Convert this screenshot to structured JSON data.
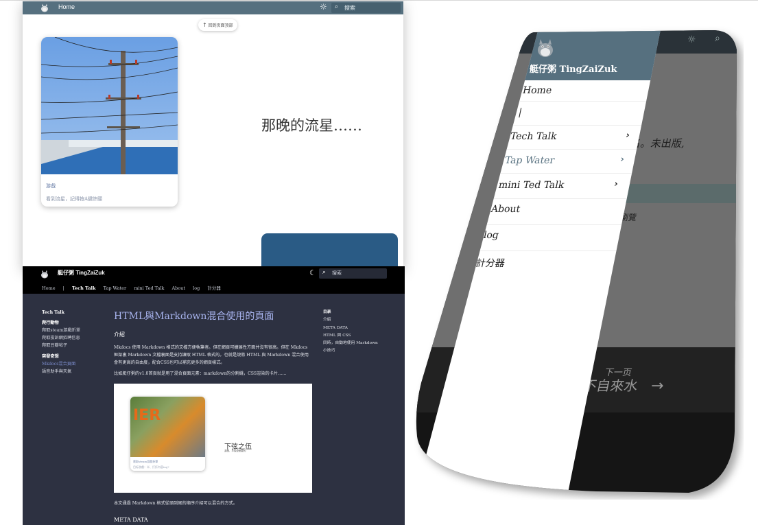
{
  "light": {
    "nav": {
      "home": "Home",
      "search_placeholder": "搜索"
    },
    "back_to_top": "回到页面顶部",
    "card": {
      "caption": "游戲",
      "desc": "看到流星，記得按A鍵許願"
    },
    "heading": "那晚的流星……"
  },
  "dark": {
    "site_name": "艇仔粥 TingZaiZuk",
    "search_placeholder": "搜索",
    "tabs": [
      "Home",
      "|",
      "Tech Talk",
      "Tap Water",
      "mini Ted Talk",
      "About",
      "log",
      "計分器"
    ],
    "left_nav": {
      "title": "Tech Talk",
      "items": [
        "爬行動物",
        "爬取steam游戲折單",
        "爬取投訴網招聘信息",
        "爬取豆瓣帖子",
        "突發奇想",
        "Mkdocs混合頁面",
        "語音助手與天氣"
      ]
    },
    "page": {
      "title": "HTML與Markdown混合使用的頁面",
      "intro_heading": "介紹",
      "intro_p1": "Mkdocs 使用 Markdown 格式的文檔方便執筆者。但在網頁可擴展性方面并沒有很高。但在 Mkdocs 框架裏 Markdown 文檔裏面是支持讀取 HTML 格式的。也就是說將 HTML 與 Markdown 混合使用會有更高的自由度，配合CSS也可以補充更多的網頁樣式。",
      "intro_p2": "比如艇仔粥的v1.0首頁就是用了混合頁面元素：markdown的分割綫，CSS渲染的卡片……",
      "embed": {
        "game_text": "IER",
        "card_caption": "爬取steam游戲折單",
        "card_desc": "目标游戲：半、打折內容ing?",
        "title": "下弦之伍",
        "subtitle": "游戲、半價全都要的"
      },
      "after_embed": "本文通過 Markdown 格式從頭到尾的順序介紹可以混合的方式。",
      "section2": "META DATA"
    },
    "toc": {
      "title": "目录",
      "items": [
        "介紹",
        "META DATA",
        "HTML 與 CSS",
        "同時，自動地使用 Markdown",
        "小技巧"
      ]
    }
  },
  "phone": {
    "site_name": "艇仔粥 TingZaiZuk",
    "nav": [
      {
        "label": "Home",
        "chevron": false,
        "selected": false
      },
      {
        "label": "|",
        "chevron": false,
        "selected": false
      },
      {
        "label": "Tech Talk",
        "chevron": true,
        "selected": false
      },
      {
        "label": "Tap Water",
        "chevron": true,
        "selected": true
      },
      {
        "label": "mini Ted Talk",
        "chevron": true,
        "selected": false
      },
      {
        "label": "About",
        "chevron": false,
        "selected": false
      },
      {
        "label": "log",
        "chevron": false,
        "selected": false
      },
      {
        "label": "計分器",
        "chevron": false,
        "selected": false
      }
    ],
    "bg_text1": "取名。未出版,",
    "bg_text2": "瀏覽",
    "next_label": "下一页",
    "next_title": "不自來水",
    "colors": {
      "header": "#56707f",
      "selected": "#56707f"
    }
  }
}
